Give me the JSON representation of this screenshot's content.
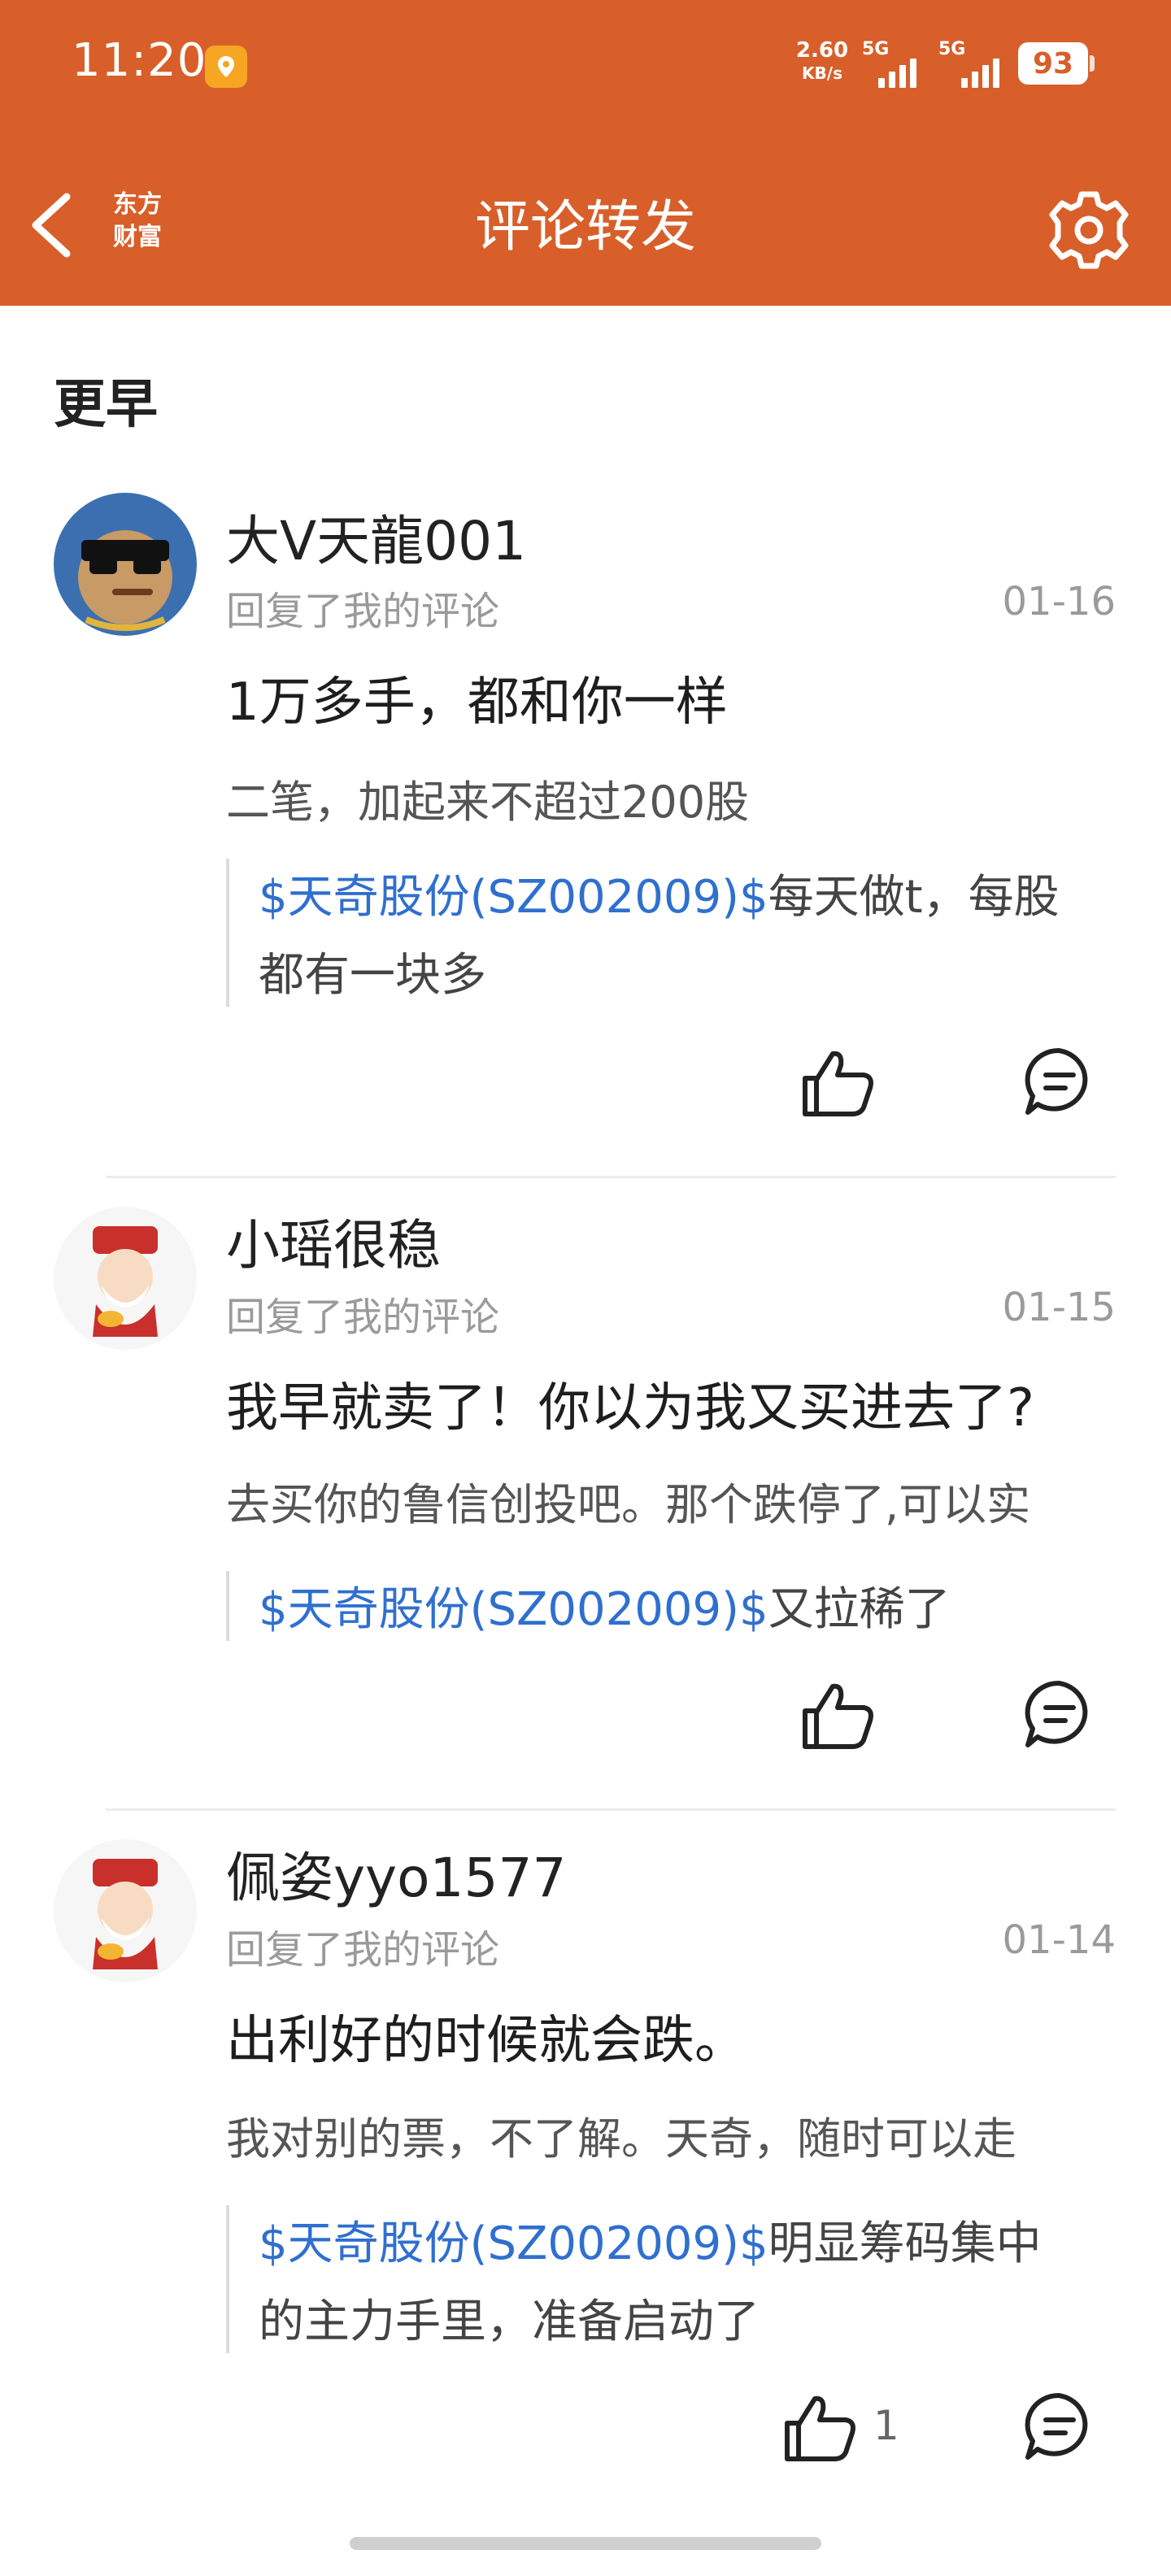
{
  "status_bar": {
    "time": "11:20",
    "net_speed_value": "2.60",
    "net_speed_unit": "KB/s",
    "signal1_label": "5G",
    "signal2_label": "5G",
    "battery": "93",
    "app_icon": "maps-pin-icon"
  },
  "nav": {
    "title": "评论转发",
    "logo_line1": "东方",
    "logo_line2": "财富",
    "back_icon": "chevron-left-icon",
    "settings_icon": "gear-icon"
  },
  "section_title": "更早",
  "items": [
    {
      "username": "大V天龍001",
      "action": "回复了我的评论",
      "date": "01-16",
      "reply": "1万多手，都和你一样",
      "subtext": "二笔，加起来不超过200股",
      "stock_link": "$天奇股份(SZ002009)$",
      "quote_rest_line1": "每天做t，每股",
      "quote_rest_line2": "都有一块多",
      "like_count": ""
    },
    {
      "username": "小瑶很稳",
      "action": "回复了我的评论",
      "date": "01-15",
      "reply": "我早就卖了！你以为我又买进去了?",
      "subtext": "去买你的鲁信创投吧。那个跌停了,可以实",
      "stock_link": "$天奇股份(SZ002009)$",
      "quote_rest_line1": "又拉稀了",
      "quote_rest_line2": "",
      "like_count": ""
    },
    {
      "username": "佩姿yyo1577",
      "action": "回复了我的评论",
      "date": "01-14",
      "reply": "出利好的时候就会跌。",
      "subtext": "我对别的票，不了解。天奇，随时可以走",
      "stock_link": "$天奇股份(SZ002009)$",
      "quote_rest_line1": "明显筹码集中",
      "quote_rest_line2": "的主力手里，准备启动了",
      "like_count": "1"
    }
  ],
  "colors": {
    "brand": "#d85f2a",
    "link": "#2f6fcf"
  }
}
